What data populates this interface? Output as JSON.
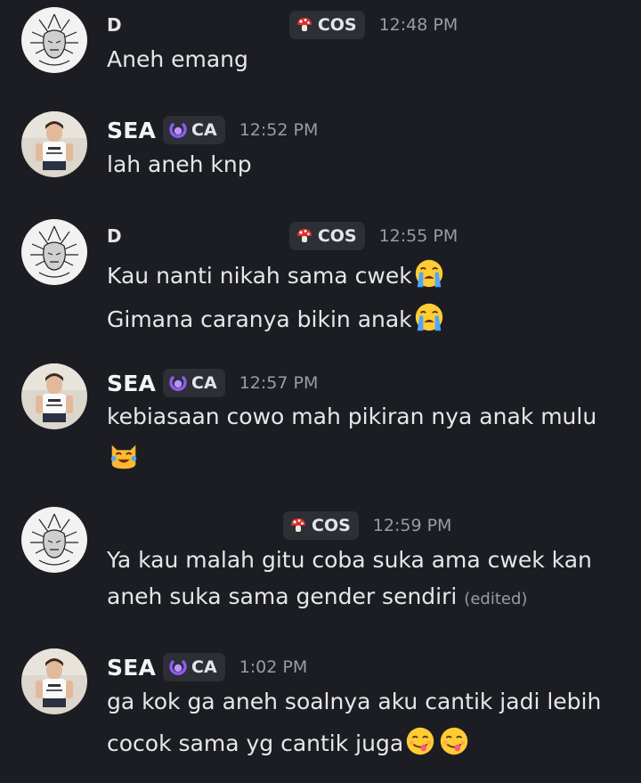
{
  "messages": [
    {
      "author": "D",
      "author_redacted": true,
      "tag": "COS",
      "time": "12:48 PM",
      "lines": [
        "Aneh emang"
      ]
    },
    {
      "author": "SEA",
      "tag": "CA",
      "time": "12:52 PM",
      "lines": [
        "lah aneh knp"
      ]
    },
    {
      "author": "D",
      "author_redacted": true,
      "tag": "COS",
      "time": "12:55 PM",
      "lines": [
        "Kau nanti nikah sama cwek",
        "Gimana caranya bikin anak"
      ]
    },
    {
      "author": "SEA",
      "tag": "CA",
      "time": "12:57 PM",
      "lines": [
        "kebiasaan cowo mah pikiran nya anak mulu"
      ]
    },
    {
      "author": "D",
      "author_redacted": true,
      "tag": "COS",
      "time": "12:59 PM",
      "lines": [
        "Ya kau malah gitu coba suka ama cwek kan",
        "aneh suka sama gender sendiri"
      ],
      "edited": "(edited)"
    },
    {
      "author": "SEA",
      "tag": "CA",
      "time": "1:02 PM",
      "lines": [
        "ga kok ga aneh soalnya aku cantik jadi lebih",
        "cocok sama yg cantik juga"
      ]
    }
  ],
  "icons": {
    "cos_tag": "mushroom-icon",
    "ca_tag": "crescent-ring-icon",
    "crying_face": "loudly-crying-face-emoji",
    "cat_joy": "cat-tears-of-joy-emoji",
    "yum_face": "face-savoring-food-emoji"
  },
  "colors": {
    "background": "#1c1d22",
    "tag_bg": "#2d2f36",
    "timestamp": "#9a9ca3",
    "ca_icon": "#8f5cf0",
    "cos_icon": "#d9322b"
  }
}
